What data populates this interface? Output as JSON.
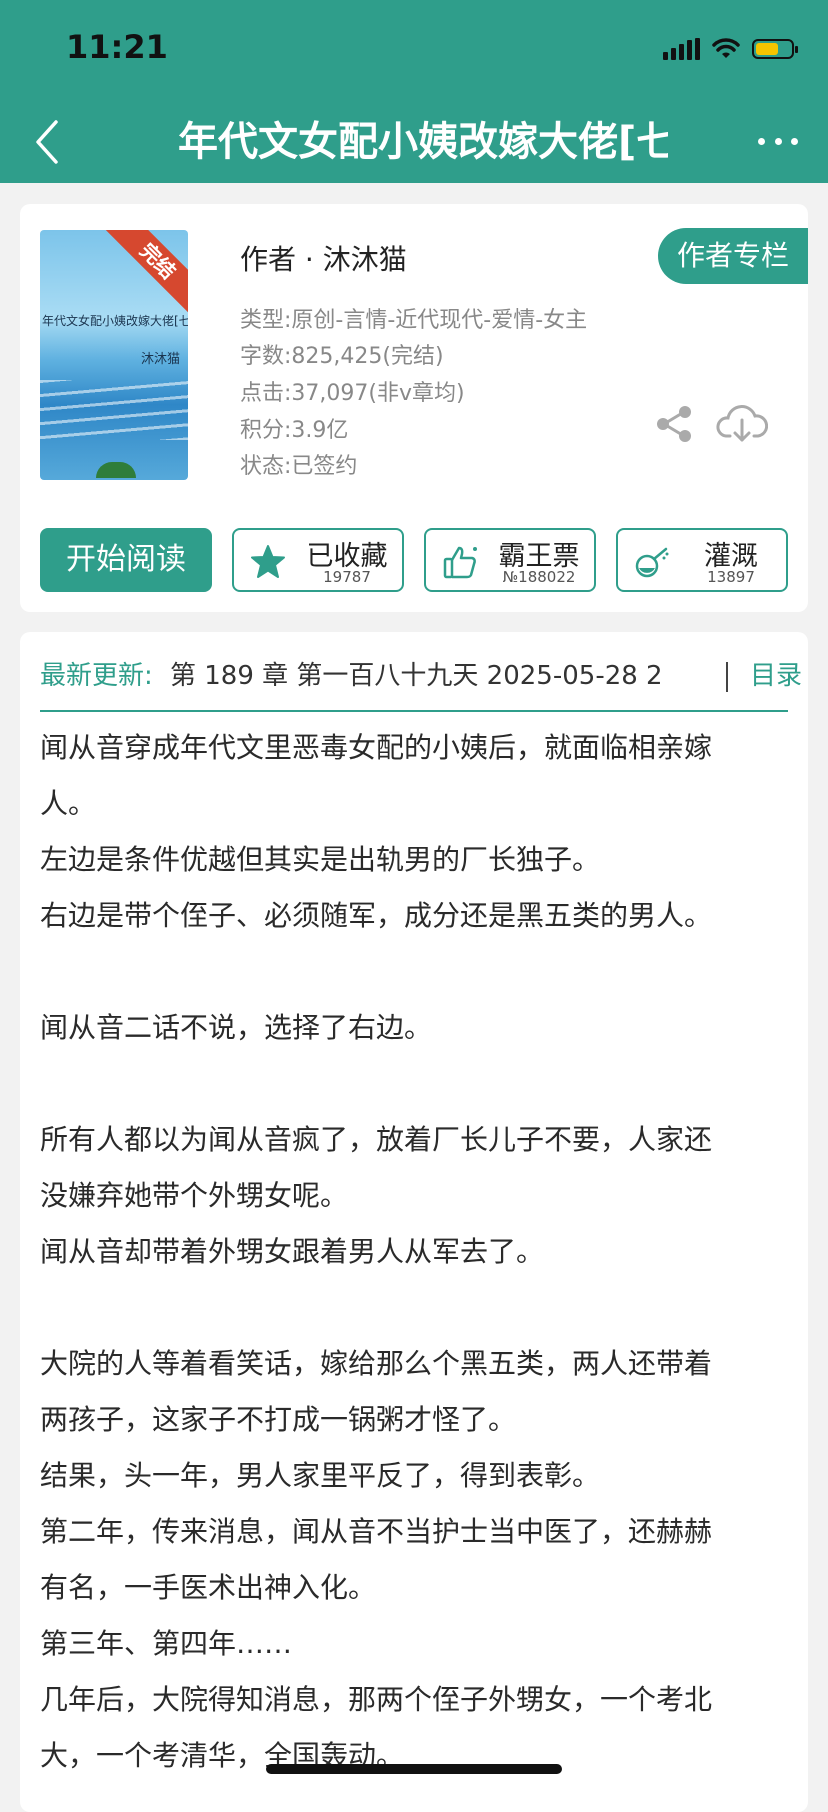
{
  "status_bar": {
    "time": "11:21"
  },
  "nav": {
    "title": "年代文女配小姨改嫁大佬[七零]"
  },
  "book": {
    "cover": {
      "ribbon": "完结",
      "title": "年代文女配小姨改嫁大佬[七零]",
      "author": "沐沐猫"
    },
    "author_line": "作者 · 沐沐猫",
    "author_column_label": "作者专栏",
    "meta": [
      "类型:原创-言情-近代现代-爱情-女主",
      "字数:825,425(完结)",
      "点击:37,097(非v章均)",
      "积分:3.9亿",
      "状态:已签约"
    ]
  },
  "actions": {
    "read_label": "开始阅读",
    "favorite": {
      "label": "已收藏",
      "count": "19787"
    },
    "ticket": {
      "label": "霸王票",
      "count": "№188022"
    },
    "water": {
      "label": "灌溉",
      "count": "13897"
    }
  },
  "update": {
    "label": "最新更新:",
    "text": "第 189 章 第一百八十九天 2025-05-28 2",
    "toc_label": "目录"
  },
  "description": [
    "闻从音穿成年代文里恶毒女配的小姨后，就面临相亲嫁",
    "人。",
    "左边是条件优越但其实是出轨男的厂长独子。",
    "右边是带个侄子、必须随军，成分还是黑五类的男人。",
    "",
    "闻从音二话不说，选择了右边。",
    "",
    "所有人都以为闻从音疯了，放着厂长儿子不要，人家还",
    "没嫌弃她带个外甥女呢。",
    "闻从音却带着外甥女跟着男人从军去了。",
    "",
    "大院的人等着看笑话，嫁给那么个黑五类，两人还带着",
    "两孩子，这家子不打成一锅粥才怪了。",
    "结果，头一年，男人家里平反了，得到表彰。",
    "第二年，传来消息，闻从音不当护士当中医了，还赫赫",
    "有名，一手医术出神入化。",
    "第三年、第四年……",
    "几年后，大院得知消息，那两个侄子外甥女，一个考北",
    "大，一个考清华，全国轰动。"
  ],
  "colors": {
    "accent": "#2f9e8b",
    "ribbon": "#d6482f",
    "battery": "#f5c400"
  },
  "icons": [
    "back-arrow-icon",
    "more-icon",
    "share-icon",
    "download-icon",
    "star-icon",
    "thumbs-up-icon",
    "watering-icon"
  ]
}
